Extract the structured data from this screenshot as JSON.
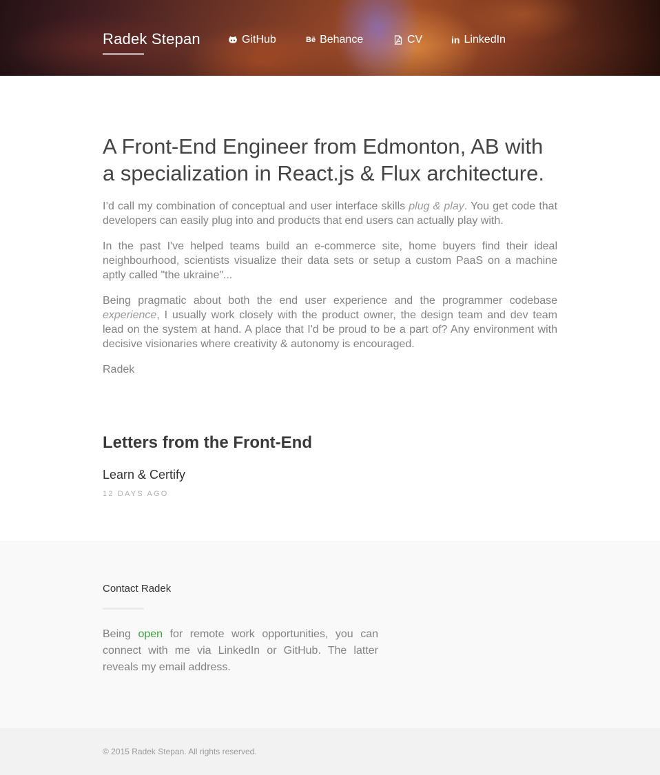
{
  "header": {
    "brand": "Radek Stepan",
    "nav": [
      {
        "label": "GitHub",
        "icon": "github-icon"
      },
      {
        "label": "Behance",
        "icon": "behance-icon",
        "icon_text": "Bē"
      },
      {
        "label": "CV",
        "icon": "pdf-file-icon"
      },
      {
        "label": "LinkedIn",
        "icon": "linkedin-icon",
        "icon_text": "in"
      }
    ]
  },
  "intro": {
    "headline": "A Front-End Engineer from Edmonton, AB with a specialization in React.js & Flux architecture.",
    "p1_before": "I’d call my combination of conceptual and user interface skills ",
    "p1_em": "plug & play",
    "p1_after": ". You get code that developers can easily plug into and products that end users can actually play with.",
    "p2": "In the past I've helped teams build an e-commerce site, home buyers find their ideal neighbourhood, scientists visualize their data sets or setup a custom PaaS on a machine aptly called \"the ukraine\"...",
    "p3_before": "Being pragmatic about both the end user experience and the programmer codebase ",
    "p3_em": "experience",
    "p3_after": ", I usually work closely with the product owner, the design team and dev team lead on the system at hand. A place that I'd be proud to be a part of? Any environment with decisive visionaries where creativity & autonomy is encouraged.",
    "signature": "Radek"
  },
  "letters": {
    "title": "Letters from the Front-End",
    "posts": [
      {
        "title": "Learn & Certify",
        "date": "12 DAYS AGO"
      }
    ]
  },
  "contact": {
    "title": "Contact Radek",
    "text_before": "Being ",
    "text_highlight": "open",
    "text_after": " for remote work opportunities, you can connect with me via LinkedIn or GitHub. The latter reveals my email address.",
    "highlight_color": "#3aa33a"
  },
  "footer": {
    "copyright": "© 2015 Radek Stepan. All rights reserved."
  }
}
